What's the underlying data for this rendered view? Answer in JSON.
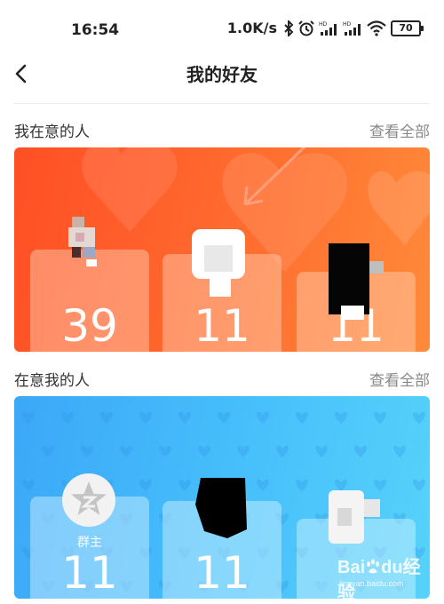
{
  "status_bar": {
    "time": "16:54",
    "net_speed": "1.0K/s",
    "battery": "70"
  },
  "nav": {
    "title": "我的好友"
  },
  "sections": [
    {
      "title": "我在意的人",
      "see_all": "查看全部",
      "counts": [
        "39",
        "11",
        "11"
      ]
    },
    {
      "title": "在意我的人",
      "see_all": "查看全部",
      "group_owner_label": "群主",
      "counts": [
        "11",
        "11"
      ]
    }
  ],
  "watermark": {
    "brand": "Bai",
    "brand2": "du",
    "text": "经验",
    "url": "jingyan.baidu.com"
  },
  "colors": {
    "orange_card": "#ff5a2a",
    "blue_card": "#45b9fa"
  },
  "icons": [
    "back-icon",
    "bluetooth-icon",
    "alarm-icon",
    "signal-icon",
    "wifi-icon",
    "battery-icon",
    "star-avatar-icon",
    "baidu-paw-icon"
  ]
}
